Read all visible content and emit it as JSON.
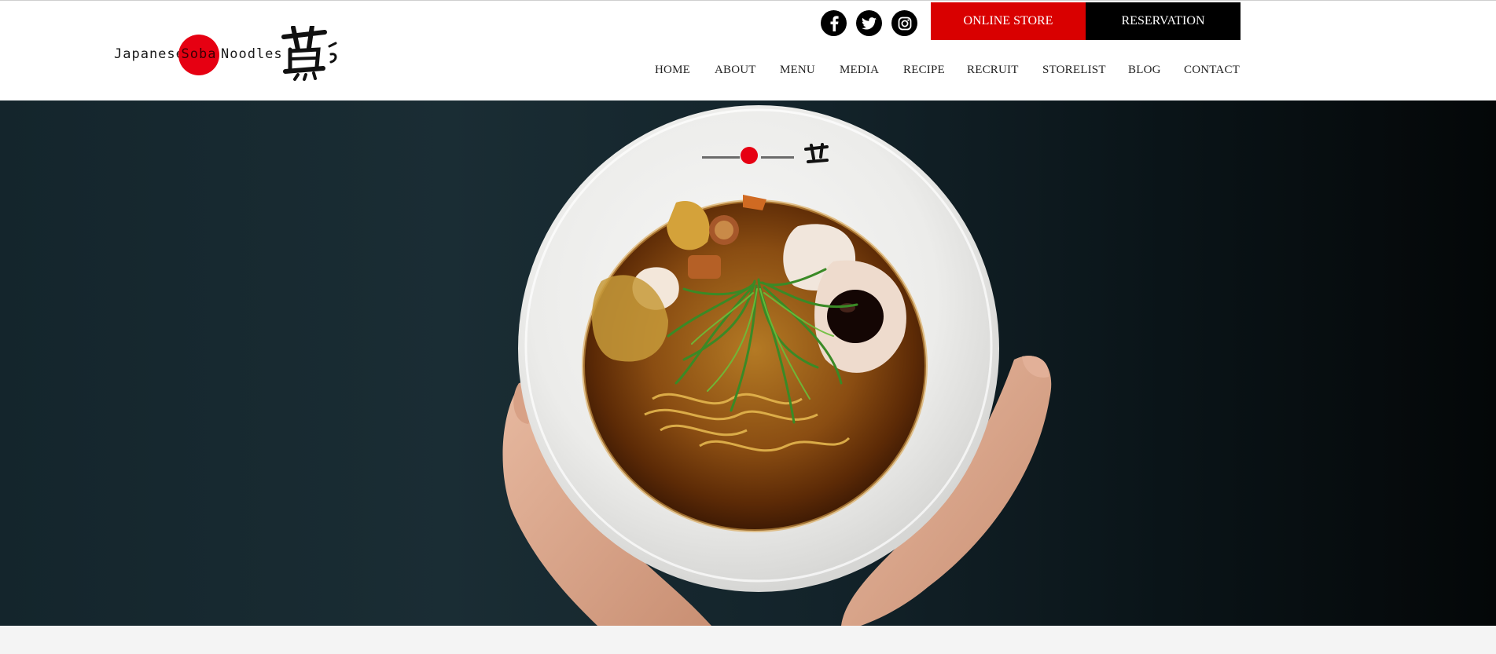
{
  "brand": {
    "logo_word1": "Japanese",
    "logo_word2": "Soba",
    "logo_word3": "Noodles",
    "accent_red": "#e60012"
  },
  "social": [
    {
      "icon": "facebook-icon"
    },
    {
      "icon": "twitter-icon"
    },
    {
      "icon": "instagram-icon"
    }
  ],
  "header_buttons": {
    "online_store": "ONLINE STORE",
    "reservation": "RESERVATION",
    "online_store_color": "#d90000",
    "reservation_color": "#000000"
  },
  "nav": {
    "items": [
      "HOME",
      "ABOUT",
      "MENU",
      "MEDIA",
      "RECIPE",
      "RECRUIT",
      "STORELIST",
      "BLOG",
      "CONTACT"
    ]
  },
  "hero": {
    "image": "bowl-of-soba-ramen-held-in-hands"
  }
}
